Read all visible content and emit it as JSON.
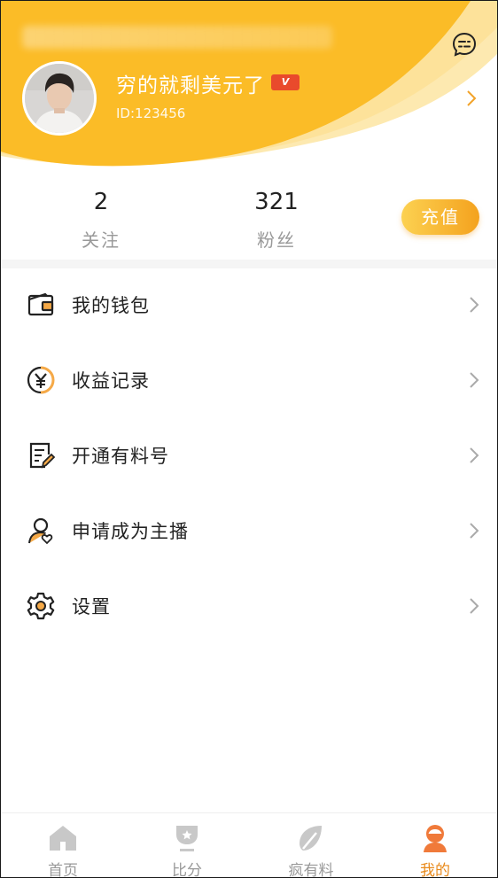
{
  "status_bar": {
    "left_text": "::"
  },
  "profile": {
    "username": "穷的就剩美元了",
    "vip_badge": "V",
    "user_id": "ID:123456"
  },
  "stats": {
    "following": {
      "value": "2",
      "label": "关注"
    },
    "fans": {
      "value": "321",
      "label": "粉丝"
    }
  },
  "recharge_button": "充值",
  "menu": [
    {
      "label": "我的钱包",
      "icon": "wallet-icon"
    },
    {
      "label": "收益记录",
      "icon": "yen-coin-icon"
    },
    {
      "label": "开通有料号",
      "icon": "edit-document-icon"
    },
    {
      "label": "申请成为主播",
      "icon": "user-heart-icon"
    },
    {
      "label": "设置",
      "icon": "gear-icon"
    }
  ],
  "tabbar": {
    "tabs": [
      {
        "label": "首页",
        "icon": "home-icon",
        "active": false
      },
      {
        "label": "比分",
        "icon": "trophy-icon",
        "active": false
      },
      {
        "label": "疯有料",
        "icon": "leaf-icon",
        "active": false
      },
      {
        "label": "我的",
        "icon": "profile-icon",
        "active": true
      }
    ]
  },
  "colors": {
    "header_yellow": "#fbbc27",
    "accent_orange": "#e98a1b",
    "gray_text": "#999999",
    "vip_red": "#e94a2c"
  }
}
